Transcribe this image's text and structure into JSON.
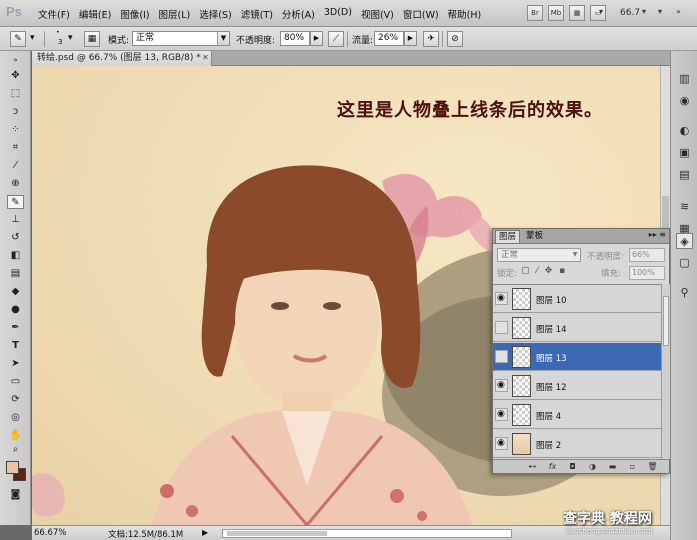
{
  "app": {
    "logo": "Ps"
  },
  "menu": [
    {
      "label": "文件(F)"
    },
    {
      "label": "编辑(E)"
    },
    {
      "label": "图像(I)"
    },
    {
      "label": "图层(L)"
    },
    {
      "label": "选择(S)"
    },
    {
      "label": "滤镜(T)"
    },
    {
      "label": "分析(A)"
    },
    {
      "label": "3D(D)"
    },
    {
      "label": "视图(V)"
    },
    {
      "label": "窗口(W)"
    },
    {
      "label": "帮助(H)"
    }
  ],
  "menubar_right": {
    "br_label": "Br",
    "mb_label": "Mb",
    "zoom": "66.7"
  },
  "options": {
    "brush_size": "3",
    "mode_label": "模式:",
    "mode_value": "正常",
    "opacity_label": "不透明度:",
    "opacity_value": "80%",
    "flow_label": "流量:",
    "flow_value": "26%"
  },
  "document": {
    "tab_title": "转绘.psd @ 66.7% (图层 13, RGB/8) *",
    "caption": "这里是人物叠上线条后的效果。"
  },
  "status": {
    "zoom": "66.67%",
    "doc_info": "文档:12.5M/86.1M"
  },
  "watermark": {
    "main": "查字典 教程网",
    "sub": "jiaocheng.chazidian.com"
  },
  "colors": {
    "foreground": "#e9c3a4",
    "background": "#5a2418",
    "selection": "#3d68b4"
  },
  "layers_panel": {
    "tabs": [
      {
        "label": "图层"
      },
      {
        "label": "蒙板"
      }
    ],
    "blend_mode": "正常",
    "opacity_label": "不透明度:",
    "opacity_value": "66%",
    "lock_label": "锁定:",
    "fill_label": "填充:",
    "fill_value": "100%",
    "layers": [
      {
        "name": "图层 10",
        "visible": true,
        "selected": false,
        "thumb": "transparent"
      },
      {
        "name": "图层 14",
        "visible": false,
        "selected": false,
        "thumb": "transparent"
      },
      {
        "name": "图层 13",
        "visible": false,
        "selected": true,
        "thumb": "transparent"
      },
      {
        "name": "图层 12",
        "visible": true,
        "selected": false,
        "thumb": "transparent"
      },
      {
        "name": "图层 4",
        "visible": true,
        "selected": false,
        "thumb": "transparent"
      },
      {
        "name": "图层 2",
        "visible": true,
        "selected": false,
        "thumb": "photo"
      }
    ]
  }
}
